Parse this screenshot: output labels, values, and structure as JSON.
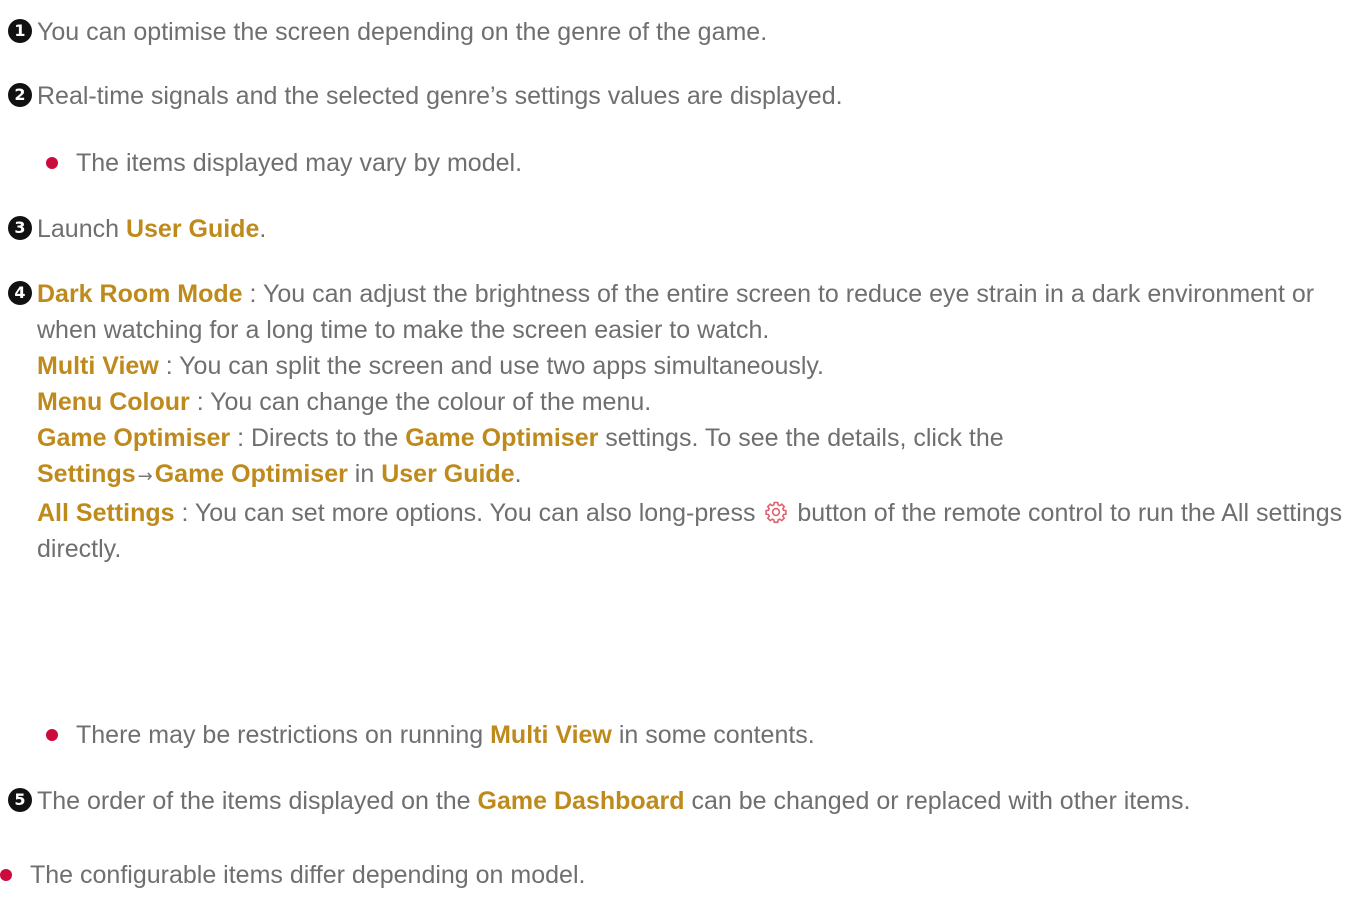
{
  "items": [
    {
      "number": "1",
      "text": "You can optimise the screen depending on the genre of the game."
    },
    {
      "number": "2",
      "text": "Real-time signals and the selected genre’s settings values are displayed.",
      "note": "The items displayed may vary by model."
    },
    {
      "number": "3",
      "prefix": "Launch ",
      "keyword": "User Guide",
      "suffix": "."
    },
    {
      "number": "4",
      "dark_room": {
        "keyword": "Dark Room Mode",
        "text": " : You can adjust the brightness of the entire screen to reduce eye strain in a dark environment or when watching for a long time to make the screen easier to watch."
      },
      "multi_view": {
        "keyword": "Multi View",
        "text": " : You can split the screen and use two apps simultaneously."
      },
      "menu_colour": {
        "keyword": "Menu Colour",
        "text": " : You can change the colour of the menu."
      },
      "game_optimiser": {
        "keyword": "Game Optimiser",
        "text1": " : Directs to the ",
        "keyword2": "Game Optimiser",
        "text2": " settings. To see the details, click the ",
        "keyword3": "Settings",
        "arrow": "→",
        "keyword4": "Game Optimiser",
        "text3": " in ",
        "keyword5": "User Guide",
        "text4": "."
      },
      "all_settings": {
        "keyword": "All Settings",
        "text1": " : You can set more options. You can also long-press ",
        "icon": "settings-gear-icon",
        "text2": " button of the remote control to run the All settings directly."
      },
      "note": {
        "prefix": "There may be restrictions on running ",
        "keyword": "Multi View",
        "suffix": " in some contents."
      }
    },
    {
      "number": "5",
      "prefix": "The order of the items displayed on the ",
      "keyword": "Game Dashboard",
      "suffix": " can be changed or replaced with other items."
    }
  ],
  "footer_note": "The configurable items differ depending on model.",
  "colors": {
    "keyword": "#bf8a1c",
    "body_text": "#6f6f6f",
    "bullet": "#cc0a3c",
    "number_badge": "#111111",
    "gear_icon": "#e06070"
  }
}
